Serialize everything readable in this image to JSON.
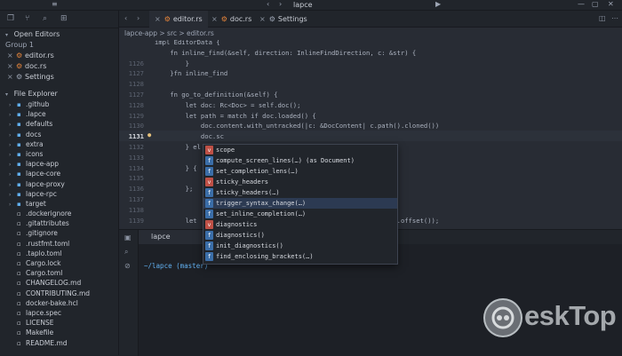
{
  "titlebar": {
    "title": "lapce",
    "run_icon": "play-icon",
    "win_min": "—",
    "win_max": "▢",
    "win_close": "✕"
  },
  "sidebar": {
    "open_editors_label": "Open Editors",
    "group_label": "Group 1",
    "open_files": [
      {
        "name": "editor.rs"
      },
      {
        "name": "doc.rs"
      },
      {
        "name": "Settings"
      }
    ],
    "file_explorer_label": "File Explorer",
    "tree": [
      {
        "name": ".github",
        "type": "folder"
      },
      {
        "name": ".lapce",
        "type": "folder"
      },
      {
        "name": "defaults",
        "type": "folder"
      },
      {
        "name": "docs",
        "type": "folder"
      },
      {
        "name": "extra",
        "type": "folder"
      },
      {
        "name": "icons",
        "type": "folder"
      },
      {
        "name": "lapce-app",
        "type": "folder"
      },
      {
        "name": "lapce-core",
        "type": "folder"
      },
      {
        "name": "lapce-proxy",
        "type": "folder"
      },
      {
        "name": "lapce-rpc",
        "type": "folder"
      },
      {
        "name": "target",
        "type": "folder"
      },
      {
        "name": ".dockerignore",
        "type": "file"
      },
      {
        "name": ".gitattributes",
        "type": "file"
      },
      {
        "name": ".gitignore",
        "type": "file"
      },
      {
        "name": ".rustfmt.toml",
        "type": "file"
      },
      {
        "name": ".taplo.toml",
        "type": "file"
      },
      {
        "name": "Cargo.lock",
        "type": "file"
      },
      {
        "name": "Cargo.toml",
        "type": "file"
      },
      {
        "name": "CHANGELOG.md",
        "type": "file"
      },
      {
        "name": "CONTRIBUTING.md",
        "type": "file"
      },
      {
        "name": "docker-bake.hcl",
        "type": "file"
      },
      {
        "name": "lapce.spec",
        "type": "file"
      },
      {
        "name": "LICENSE",
        "type": "file"
      },
      {
        "name": "Makefile",
        "type": "file"
      },
      {
        "name": "README.md",
        "type": "file"
      }
    ]
  },
  "tabs": [
    {
      "label": "editor.rs",
      "active": true
    },
    {
      "label": "doc.rs",
      "active": false
    },
    {
      "label": "Settings",
      "active": false
    }
  ],
  "breadcrumb": "lapce-app > src > editor.rs",
  "editor": {
    "lines": [
      {
        "num": "",
        "text": "impl EditorData {"
      },
      {
        "num": "",
        "text": "    fn inline_find(&self, direction: InlineFindDirection, c: &str) {"
      },
      {
        "num": "1126",
        "text": "        }"
      },
      {
        "num": "1127",
        "text": "    }fn inline_find"
      },
      {
        "num": "1128",
        "text": ""
      },
      {
        "num": "1127",
        "text": "    fn go_to_definition(&self) {"
      },
      {
        "num": "1128",
        "text": "        let doc: Rc<Doc> = self.doc();"
      },
      {
        "num": "1129",
        "text": "        let path = match if doc.loaded() {"
      },
      {
        "num": "1130",
        "text": "            doc.content.with_untracked(|c: &DocContent| c.path().cloned())"
      },
      {
        "num": "1131",
        "text": "            doc.sc"
      },
      {
        "num": "1132",
        "text": "        } el"
      },
      {
        "num": "1133",
        "text": ""
      },
      {
        "num": "1134",
        "text": "        } {"
      },
      {
        "num": "1135",
        "text": ""
      },
      {
        "num": "1136",
        "text": "        };"
      },
      {
        "num": "1137",
        "text": ""
      },
      {
        "num": "1138",
        "text": ""
      },
      {
        "num": "1139",
        "text": "        let                                              sor| c.offset());"
      }
    ],
    "current_line": "1131"
  },
  "completion": {
    "items": [
      {
        "kind": "v",
        "label": "scope"
      },
      {
        "kind": "f",
        "label": "compute_screen_lines(…) (as Document)"
      },
      {
        "kind": "f",
        "label": "set_completion_lens(…)"
      },
      {
        "kind": "v",
        "label": "sticky_headers"
      },
      {
        "kind": "f",
        "label": "sticky_headers(…)"
      },
      {
        "kind": "f",
        "label": "trigger_syntax_change(…)"
      },
      {
        "kind": "f",
        "label": "set_inline_completion(…)"
      },
      {
        "kind": "v",
        "label": "diagnostics"
      },
      {
        "kind": "f",
        "label": "diagnostics()"
      },
      {
        "kind": "f",
        "label": "init_diagnostics()"
      },
      {
        "kind": "f",
        "label": "find_enclosing_brackets(…)"
      }
    ],
    "selected_index": 5
  },
  "terminal": {
    "tab_label": "lapce",
    "prompt": "~/lapce (master)"
  },
  "watermark": {
    "text": "eskTop"
  }
}
